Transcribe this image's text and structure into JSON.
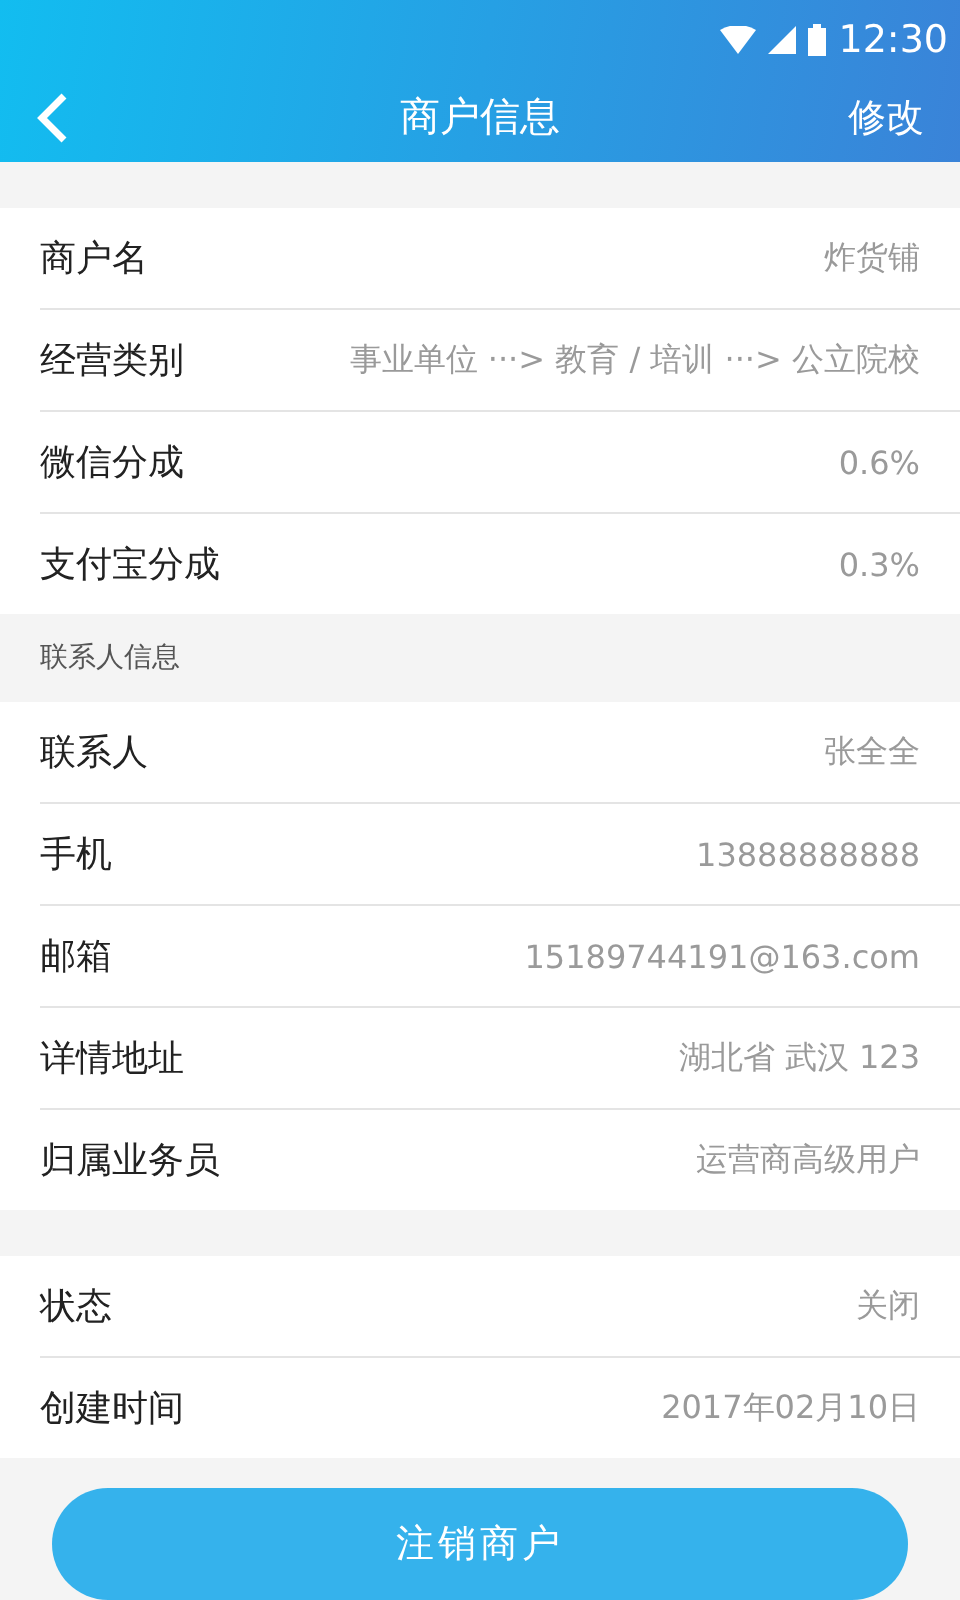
{
  "status_bar": {
    "time": "12:30"
  },
  "header": {
    "title": "商户信息",
    "action": "修改"
  },
  "groups": [
    {
      "rows": [
        {
          "label": "商户名",
          "value": "炸货铺"
        },
        {
          "label": "经营类别",
          "value": "事业单位 ···> 教育 / 培训 ···> 公立院校"
        },
        {
          "label": "微信分成",
          "value": "0.6%"
        },
        {
          "label": "支付宝分成",
          "value": "0.3%"
        }
      ]
    },
    {
      "heading": "联系人信息",
      "rows": [
        {
          "label": "联系人",
          "value": "张全全"
        },
        {
          "label": "手机",
          "value": "13888888888"
        },
        {
          "label": "邮箱",
          "value": "15189744191@163.com"
        },
        {
          "label": "详情地址",
          "value": "湖北省 武汉 123"
        },
        {
          "label": "归属业务员",
          "value": "运营商高级用户"
        }
      ]
    },
    {
      "rows": [
        {
          "label": "状态",
          "value": "关闭"
        },
        {
          "label": "创建时间",
          "value": "2017年02月10日"
        }
      ]
    }
  ],
  "button": "注销商户"
}
